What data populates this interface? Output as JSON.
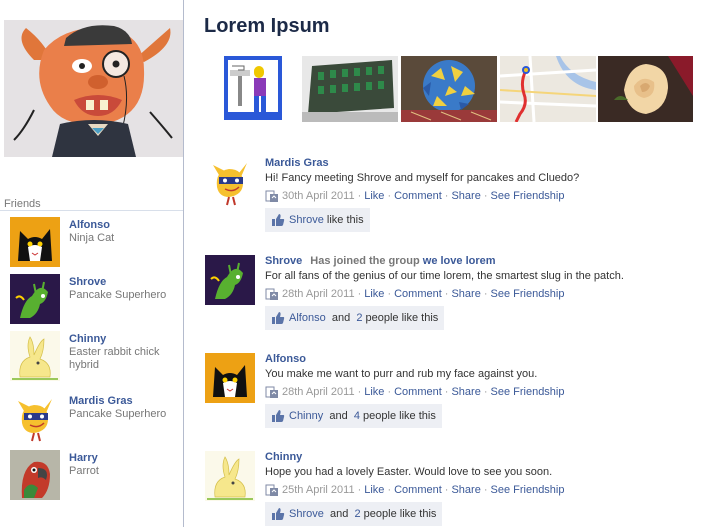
{
  "page": {
    "title": "Lorem Ipsum"
  },
  "friends_title": "Friends",
  "friends": [
    {
      "name": "Alfonso",
      "desc": "Ninja Cat"
    },
    {
      "name": "Shrove",
      "desc": "Pancake Superhero"
    },
    {
      "name": "Chinny",
      "desc": "Easter rabbit chick hybrid"
    },
    {
      "name": "Mardis Gras",
      "desc": "Pancake Superhero"
    },
    {
      "name": "Harry",
      "desc": "Parrot"
    }
  ],
  "photos": [
    "photo-washbasin",
    "photo-building",
    "photo-origami",
    "photo-map",
    "photo-rose"
  ],
  "labels": {
    "like": "Like",
    "comment": "Comment",
    "share": "Share",
    "see_friendship": "See Friendship",
    "and": "and",
    "sep": "·"
  },
  "posts": [
    {
      "name": "Mardis Gras",
      "text": "Hi! Fancy meeting Shrove and myself for pancakes and Cluedo?",
      "date": "30th April 2011",
      "likers": "Shrove",
      "likes_tail": "like this"
    },
    {
      "name": "Shrove",
      "action": "Has joined the group",
      "group": "we love lorem",
      "text": "For all fans of the genius of our time lorem, the smartest slug in the patch.",
      "date": "28th April 2011",
      "likers": "Alfonso",
      "others": "2",
      "likes_tail": "people like this"
    },
    {
      "name": "Alfonso",
      "text": "You make me want to purr and rub my face against you.",
      "date": "28th April 2011",
      "likers": "Chinny",
      "others": "4",
      "likes_tail": "people like this"
    },
    {
      "name": "Chinny",
      "text": "Hope you had a lovely Easter. Would love to see you soon.",
      "date": "25th April 2011",
      "likers": "Shrove",
      "others": "2",
      "likes_tail": "people like this"
    }
  ]
}
